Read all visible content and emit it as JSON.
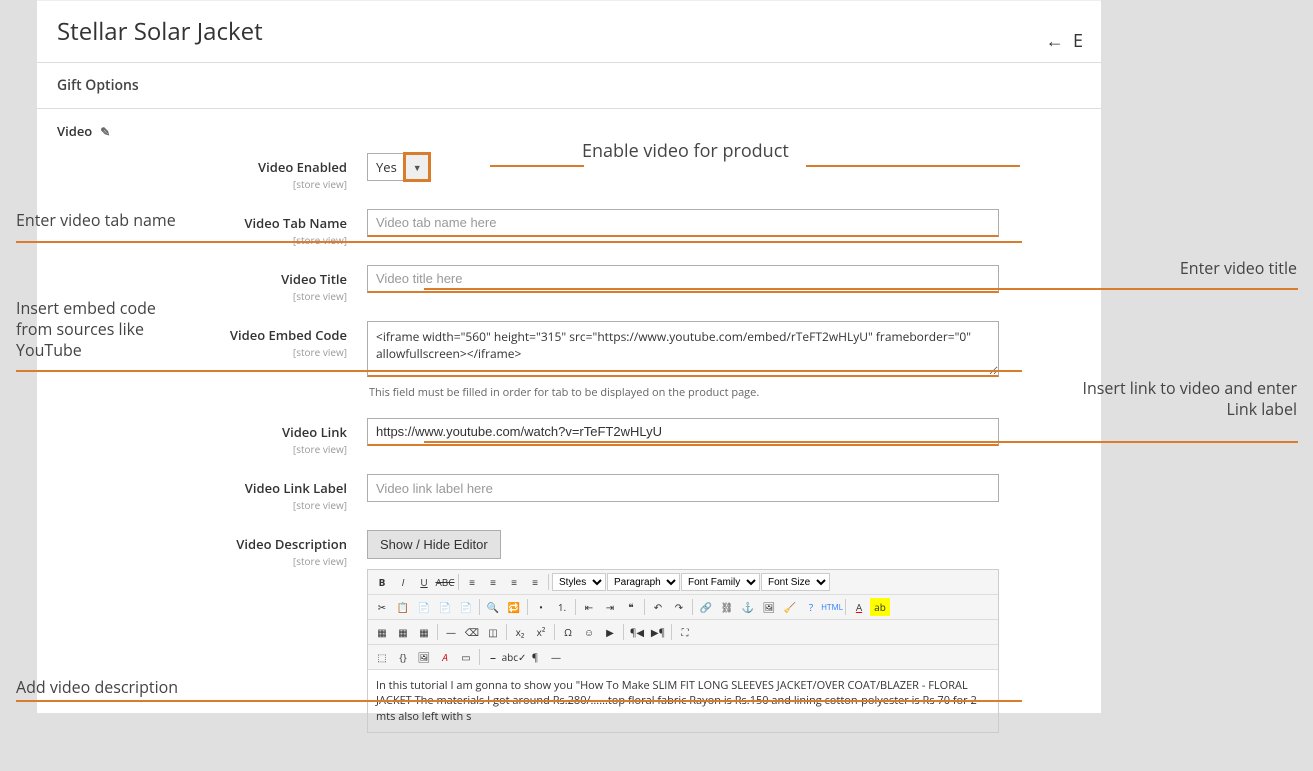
{
  "page_title": "Stellar Solar Jacket",
  "sections": {
    "gift_options": "Gift Options",
    "video": "Video"
  },
  "fields": {
    "video_enabled": {
      "label": "Video Enabled",
      "scope": "[store view]",
      "value": "Yes"
    },
    "video_tab_name": {
      "label": "Video Tab Name",
      "scope": "[store view]",
      "placeholder": "Video tab name here",
      "value": ""
    },
    "video_title": {
      "label": "Video Title",
      "scope": "[store view]",
      "placeholder": "Video title here",
      "value": ""
    },
    "video_embed": {
      "label": "Video Embed Code",
      "scope": "[store view]",
      "value": "<iframe width=\"560\" height=\"315\" src=\"https://www.youtube.com/embed/rTeFT2wHLyU\" frameborder=\"0\" allowfullscreen></iframe>",
      "hint": "This field must be filled in order for tab to be displayed on the product page."
    },
    "video_link": {
      "label": "Video Link",
      "scope": "[store view]",
      "value": "https://www.youtube.com/watch?v=rTeFT2wHLyU"
    },
    "video_link_label": {
      "label": "Video Link Label",
      "scope": "[store view]",
      "placeholder": "Video link label here",
      "value": ""
    },
    "video_description": {
      "label": "Video Description",
      "scope": "[store view]",
      "button": "Show / Hide Editor",
      "content": "In this tutorial I am gonna to show you \"How To Make SLIM FIT LONG SLEEVES JACKET/OVER COAT/BLAZER - FLORAL JACKET The materials I got around Rs.280/......top floral fabric Rayon is Rs.150 and lining cotton-polyester is Rs 70 for 2 mts also left with s"
    }
  },
  "editor_toolbar": {
    "styles_label": "Styles",
    "format_label": "Paragraph",
    "font_family_label": "Font Family",
    "font_size_label": "Font Size"
  },
  "annotations": {
    "enable_video": "Enable video for product",
    "tab_name": "Enter video tab name",
    "video_title": "Enter video title",
    "embed": "Insert embed code from sources like YouTube",
    "link": "Insert link to video and enter Link label",
    "description": "Add video description"
  }
}
